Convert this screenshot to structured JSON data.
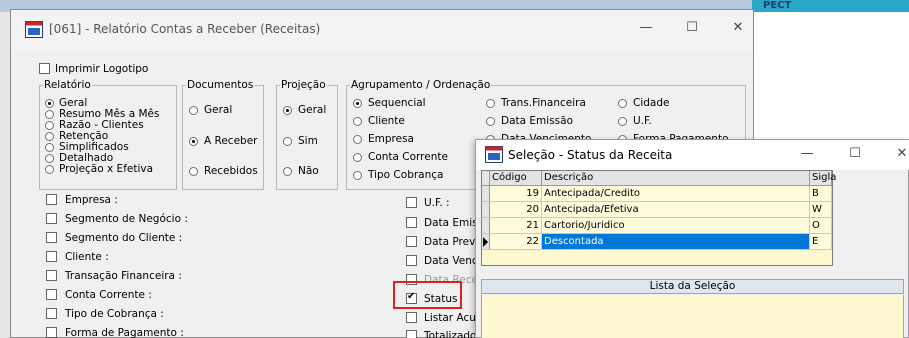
{
  "background": {
    "right_label": "PECT"
  },
  "main_window": {
    "title": "[061] - Relatório Contas a Receber (Receitas)",
    "controls": {
      "minimize": "—",
      "maximize": "☐",
      "close": "✕"
    },
    "imprimir_logotipo": "Imprimir Logotipo",
    "relatorio": {
      "legend": "Relatório",
      "options": [
        "Geral",
        "Resumo Mês a Mês",
        "Razão - Clientes",
        "Retenção",
        "Simplificados",
        "Detalhado",
        "Projeção x Efetiva"
      ]
    },
    "documentos": {
      "legend": "Documentos",
      "options": [
        "Geral",
        "A Receber",
        "Recebidos"
      ]
    },
    "projecao": {
      "legend": "Projeção",
      "options": [
        "Geral",
        "Sim",
        "Não"
      ]
    },
    "agrupamento": {
      "legend": "Agrupamento / Ordenação",
      "col1": [
        "Sequencial",
        "Cliente",
        "Empresa",
        "Conta Corrente",
        "Tipo Cobrança"
      ],
      "col2": [
        "Trans.Financeira",
        "Data Emissão",
        "Data Vencimento"
      ],
      "col3": [
        "Cidade",
        "U.F.",
        "Forma Pagamento"
      ]
    },
    "filters_left": [
      "Empresa :",
      "Segmento de Negócio :",
      "Segmento do Cliente :",
      "Cliente :",
      "Transação Financeira :",
      "Conta Corrente :",
      "Tipo de Cobrança :",
      "Forma de Pagamento :"
    ],
    "filters_right": [
      "U.F. :",
      "Data Emiss",
      "Data Previs",
      "Data Venci",
      "Data Receb",
      "Status",
      "Listar Acum",
      "Totalizado"
    ]
  },
  "selection_window": {
    "title": "Seleção - Status da Receita",
    "controls": {
      "minimize": "—",
      "maximize": "☐",
      "close": "✕"
    },
    "columns": [
      "Código",
      "Descrição",
      "Sigla"
    ],
    "rows": [
      {
        "codigo": "19",
        "descricao": "Antecipada/Credito",
        "sigla": "B"
      },
      {
        "codigo": "20",
        "descricao": "Antecipada/Efetiva",
        "sigla": "W"
      },
      {
        "codigo": "21",
        "descricao": "Cartorio/Juridico",
        "sigla": "O"
      },
      {
        "codigo": "22",
        "descricao": "Descontada",
        "sigla": "E"
      }
    ],
    "lista_header": "Lista da Seleção"
  }
}
